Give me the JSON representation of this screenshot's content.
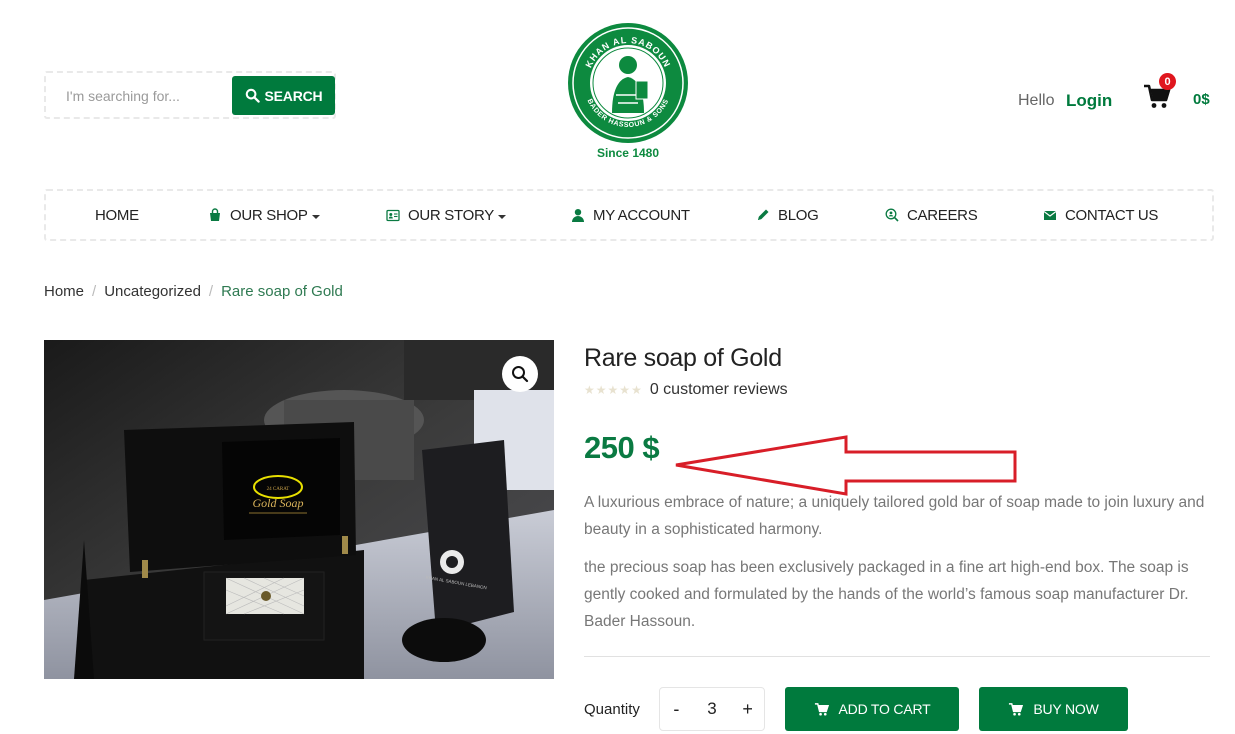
{
  "search": {
    "placeholder": "I'm searching for...",
    "button_label": "SEARCH"
  },
  "logo": {
    "since": "Since 1480",
    "ring_top": "KHAN AL SABOUN",
    "ring_bottom": "BADER HASSOUN & SONS"
  },
  "account": {
    "hello": "Hello",
    "login": "Login"
  },
  "cart": {
    "count": "0",
    "total": "0$"
  },
  "nav": [
    {
      "label": "HOME",
      "icon": "none"
    },
    {
      "label": "OUR SHOP",
      "icon": "bag-icon",
      "dropdown": true
    },
    {
      "label": "OUR STORY",
      "icon": "id-card-icon",
      "dropdown": true
    },
    {
      "label": "MY ACCOUNT",
      "icon": "user-icon"
    },
    {
      "label": "BLOG",
      "icon": "pencil-icon"
    },
    {
      "label": "CAREERS",
      "icon": "search-user-icon"
    },
    {
      "label": "CONTACT US",
      "icon": "envelope-icon"
    }
  ],
  "breadcrumb": [
    {
      "label": "Home"
    },
    {
      "label": "Uncategorized"
    },
    {
      "label": "Rare soap of Gold"
    }
  ],
  "product": {
    "title": "Rare soap of Gold",
    "rating": 0,
    "reviews": "0 customer reviews",
    "price": "250 $",
    "description_1": "A luxurious embrace of nature; a uniquely tailored gold bar of soap made to join luxury and beauty in a sophisticated harmony.",
    "description_2": "the precious soap has been exclusively packaged in a fine art high-end box. The soap is gently cooked and formulated by the hands of the world’s famous soap manufacturer Dr. Bader Hassoun.",
    "image_text": {
      "label_small": "24 CARAT",
      "label_main": "Gold Soap",
      "card_text": "KHAN AL SABOUN LEBANON"
    }
  },
  "purchase": {
    "quantity_label": "Quantity",
    "quantity": "3",
    "minus": "-",
    "plus": "+",
    "add_to_cart": "ADD TO CART",
    "buy_now": "BUY NOW"
  },
  "colors": {
    "brand_green": "#007a3d",
    "badge_red": "#e0161e",
    "annotation_red": "#d81e28"
  }
}
